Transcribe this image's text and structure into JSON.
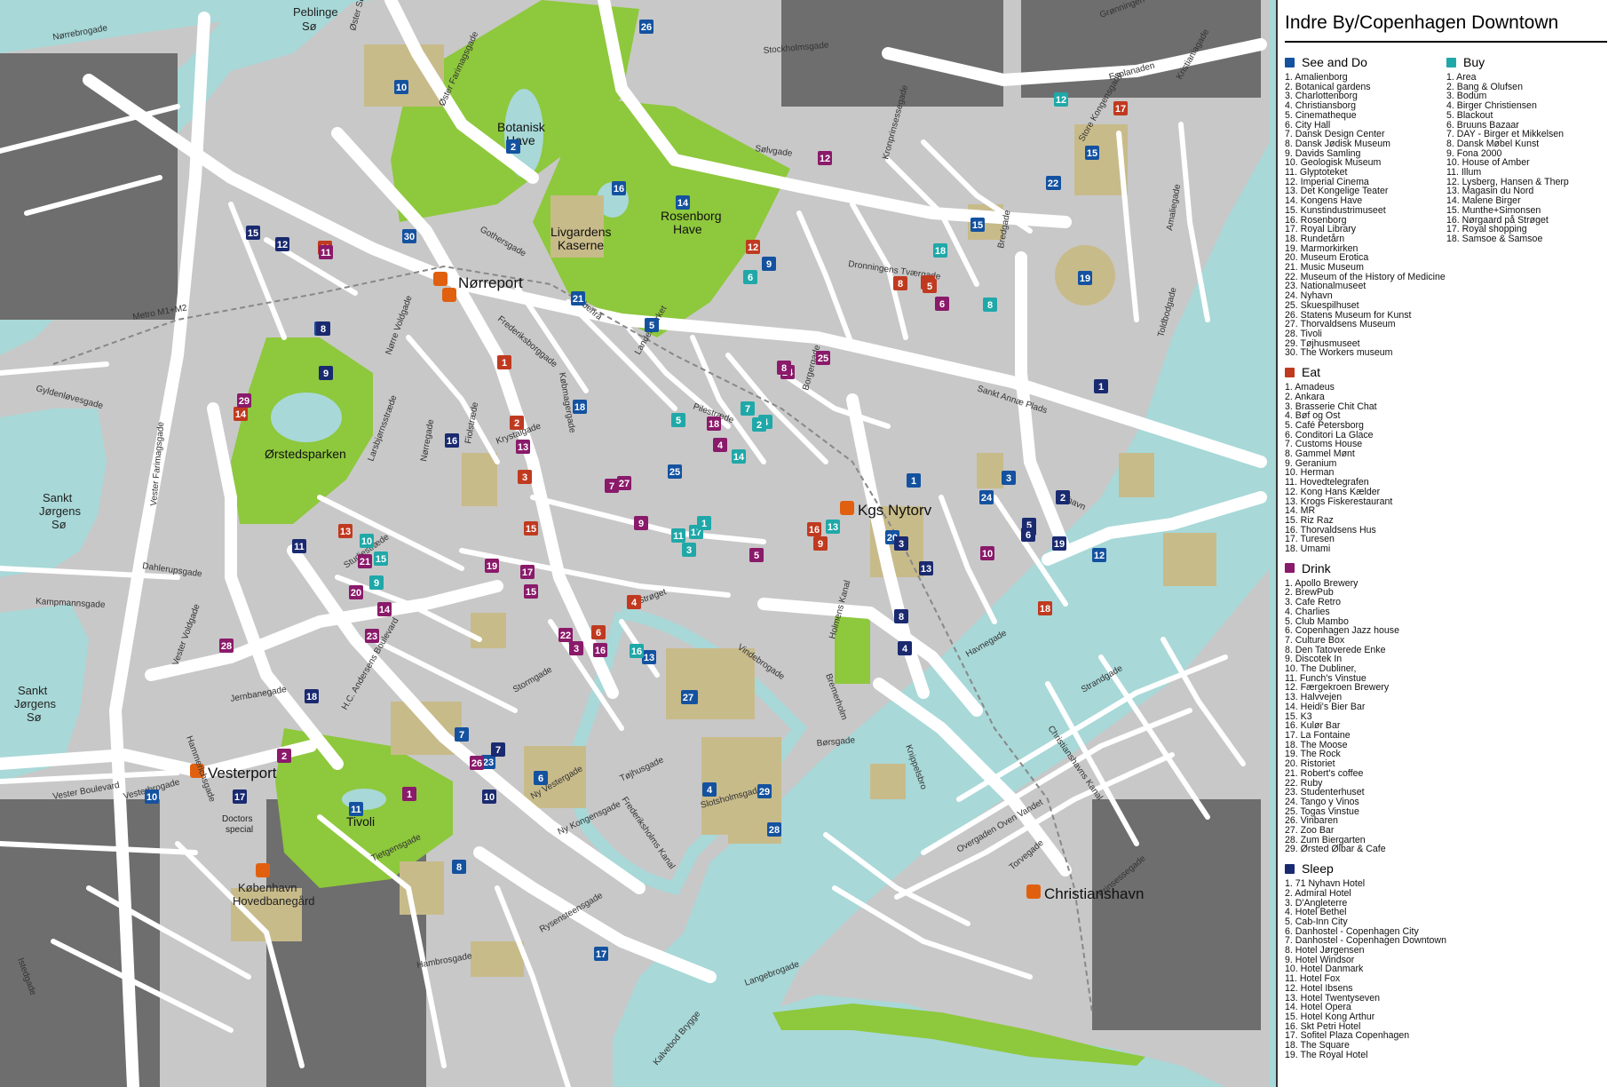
{
  "title": "Indre By/Copenhagen Downtown",
  "colors": {
    "water": "#a8d8d8",
    "land": "#c8c8c8",
    "road": "#ffffff",
    "park": "#8ec83c",
    "building": "#c8bb8a",
    "dark_block": "#6e6e6e",
    "see": "#1452a0",
    "buy": "#20a8a8",
    "eat": "#c03a20",
    "drink": "#8a1a6a",
    "sleep": "#1a2a70",
    "station": "#e06010"
  },
  "map_labels": {
    "norreport": "Nørreport",
    "kgs_nytorv": "Kgs Nytorv",
    "vesterport": "Vesterport",
    "christianshavn": "Christianshavn",
    "hovedbanegard": "København\nHovedbanegård",
    "peblinge": "Peblinge\nSø",
    "sankt_jorgens_1": "Sankt\nJørgens\nSø",
    "sankt_jorgens_2": "Sankt\nJørgens\nSø",
    "botanisk": "Botanisk\nHave",
    "rosenborg": "Rosenborg\nHave",
    "livgardens": "Livgardens\nKaserne",
    "orstedsparken": "Ørstedsparken",
    "tivoli": "Tivoli",
    "doctors": "Doctors\nspecial"
  },
  "street_labels": [
    "Nørrebrogade",
    "Øster Søgade",
    "Øster Farimagsgade",
    "Gothersgade",
    "Stockholmsgade",
    "Kronprinsessegade",
    "Dronningens Tværgade",
    "Bredgade",
    "Store Kongensgade",
    "Amaliegade",
    "Esplanaden",
    "Sankt Annæ Plads",
    "Nyhavn",
    "Havnegade",
    "Holmens Kanal",
    "Vester Voldgade",
    "H.C. Andersens Boulevard",
    "Vesterbrogade",
    "Gyldenløvesgade",
    "Nørre Voldgade",
    "Frederiksborggade",
    "Købmagergade",
    "Strøget",
    "Stormgade",
    "Tietgensgade",
    "Kalvebod Brygge",
    "Knippelsbro",
    "Torvegade",
    "Strandgade",
    "Christianshavns Kanal",
    "Prinsessegade",
    "Overgaden Oven Vandet",
    "Langebrogade",
    "Vester Farimagsgade",
    "Kampmannsgade",
    "Dahlerupsgade",
    "Istedgade",
    "Hambrosgade",
    "Hammerichsgade",
    "Jernbanegade",
    "Studiestræde",
    "Larsbjørnsstræde",
    "Fiolstræde",
    "Nørregade",
    "Krystalgade",
    "Pilestræde",
    "Landemærket",
    "Åbenrå",
    "Borgergade",
    "Sølvgade",
    "Kristianiagade",
    "Grønningen",
    "Toldbodgade",
    "Bremerholm",
    "Slotsholmsgade",
    "Børsgade",
    "Vindebrogade",
    "Tøjhusgade",
    "Frederiksholms Kanal",
    "Ny Kongensgade",
    "Ny Vestergade",
    "Rysensteensgade",
    "Vester Boulevard",
    "Metro M1+M2"
  ],
  "legend": {
    "see": {
      "heading": "See and Do",
      "items": [
        "1. Amalienborg",
        "2. Botanical gardens",
        "3. Charlottenborg",
        "4. Christiansborg",
        "5. Cinematheque",
        "6. City Hall",
        "7. Dansk Design Center",
        "8. Dansk Jødisk Museum",
        "9. Davids Samling",
        "10. Geologisk Museum",
        "11. Glyptoteket",
        "12. Imperial Cinema",
        "13. Det Kongelige Teater",
        "14. Kongens Have",
        "15. Kunstindustrimuseet",
        "16. Rosenborg",
        "17. Royal Library",
        "18. Rundetårn",
        "19. Marmorkirken",
        "20. Museum Erotica",
        "21. Music Museum",
        "22. Museum of the History of Medicine",
        "23. Nationalmuseet",
        "24. Nyhavn",
        "25. Skuespilhuset",
        "26. Statens Museum for Kunst",
        "27. Thorvaldsens Museum",
        "28. Tivoli",
        "29. Tøjhusmuseet",
        "30. The Workers museum"
      ]
    },
    "eat": {
      "heading": "Eat",
      "items": [
        "1. Amadeus",
        "2. Ankara",
        "3. Brasserie Chit Chat",
        "4. Bøf og Ost",
        "5. Café Petersborg",
        "6. Conditori La Glace",
        "7. Customs House",
        "8. Gammel Mønt",
        "9. Geranium",
        "10. Herman",
        "11. Hovedtelegrafen",
        "12. Kong Hans Kælder",
        "13. Krogs Fiskerestaurant",
        "14. MR",
        "15. Riz Raz",
        "16. Thorvaldsens Hus",
        "17. Turesen",
        "18. Umami"
      ]
    },
    "drink": {
      "heading": "Drink",
      "items": [
        "1. Apollo Brewery",
        "2. BrewPub",
        "3. Cafe Retro",
        "4. Charlies",
        "5. Club Mambo",
        "6. Copenhagen Jazz house",
        "7. Culture Box",
        "8. Den Tatoverede Enke",
        "9. Discotek In",
        "10. The Dubliner,",
        "11. Funch's Vinstue",
        "12. Færgekroen Brewery",
        "13. Halvvejen",
        "14. Heidi's Bier Bar",
        "15. K3",
        "16. Kulør Bar",
        "17. La Fontaine",
        "18. The Moose",
        "19. The Rock",
        "20. Ristoriet",
        "21. Robert's coffee",
        "22. Ruby",
        "23. Studenterhuset",
        "24. Tango y Vinos",
        "25. Togas Vinstue",
        "26. Vinbaren",
        "27. Zoo Bar",
        "28. Zum Biergarten",
        "29. Ørsted Ølbar & Cafe"
      ]
    },
    "sleep": {
      "heading": "Sleep",
      "items": [
        "1. 71 Nyhavn Hotel",
        "2. Admiral Hotel",
        "3. D'Angleterre",
        "4. Hotel Bethel",
        "5. Cab-Inn City",
        "6. Danhostel - Copenhagen City",
        "7. Danhostel - Copenhagen Downtown",
        "8. Hotel Jørgensen",
        "9. Hotel Windsor",
        "10. Hotel Danmark",
        "11. Hotel Fox",
        "12. Hotel Ibsens",
        "13. Hotel Twentyseven",
        "14. Hotel Opera",
        "15. Hotel Kong Arthur",
        "16. Skt Petri Hotel",
        "17. Sofitel Plaza Copenhagen",
        "18. The Square",
        "19. The Royal Hotel"
      ]
    },
    "buy": {
      "heading": "Buy",
      "items": [
        "1. Area",
        "2. Bang & Olufsen",
        "3. Bodum",
        "4. Birger Christiensen",
        "5. Blackout",
        "6. Bruuns Bazaar",
        "7. DAY - Birger et Mikkelsen",
        "8. Dansk Møbel Kunst",
        "9. Fona 2000",
        "10. House of Amber",
        "11. Illum",
        "12. Lysberg, Hansen & Therp",
        "13. Magasin du Nord",
        "14. Malene Birger",
        "15. Munthe+Simonsen",
        "16. Nørgaard på Strøget",
        "17. Royal shopping",
        "18. Samsoe & Samsoe"
      ]
    }
  },
  "markers": {
    "see": [
      "10",
      "26",
      "2",
      "16",
      "14",
      "30",
      "15",
      "12",
      "8",
      "21",
      "5",
      "9",
      "18",
      "16",
      "22",
      "15",
      "19",
      "1",
      "3",
      "25",
      "20",
      "4",
      "13",
      "27",
      "4",
      "29",
      "8",
      "11",
      "28",
      "17",
      "6",
      "7",
      "23",
      "10",
      "12",
      "24"
    ],
    "sleep": [
      "15",
      "12",
      "9",
      "8",
      "16",
      "11",
      "18",
      "7",
      "17",
      "10",
      "13",
      "3",
      "14",
      "8",
      "5",
      "4",
      "1",
      "2",
      "6",
      "19"
    ],
    "eat": [
      "11",
      "17",
      "14",
      "2",
      "13",
      "15",
      "18",
      "1",
      "12",
      "8",
      "16",
      "9",
      "4",
      "6",
      "3",
      "10",
      "5"
    ],
    "drink": [
      "11",
      "29",
      "7",
      "13",
      "28",
      "21",
      "14",
      "20",
      "19",
      "17",
      "15",
      "3",
      "22",
      "5",
      "4",
      "9",
      "10",
      "25",
      "24",
      "23",
      "27",
      "6",
      "16",
      "8",
      "18",
      "26",
      "2",
      "1",
      "12"
    ],
    "buy": [
      "12",
      "6",
      "8",
      "18",
      "17",
      "3",
      "11",
      "4",
      "13",
      "14",
      "1",
      "7",
      "16",
      "10",
      "15",
      "5",
      "2",
      "9"
    ]
  }
}
